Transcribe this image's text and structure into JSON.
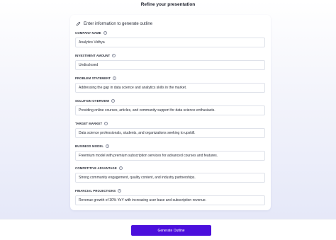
{
  "page_title": "Refine your presentation",
  "card": {
    "header_icon": "pencil-icon",
    "header_text": "Enter information to generate outline"
  },
  "fields": [
    {
      "label": "COMPANY NAME",
      "value": "Analytics Vidhya"
    },
    {
      "label": "INVESTMENT AMOUNT",
      "value": "Undisclosed"
    },
    {
      "label": "PROBLEM STATEMENT",
      "value": "Addressing the gap in data science and analytics skills in the market."
    },
    {
      "label": "SOLUTION OVERVIEW",
      "value": "Providing online courses, articles, and community support for data science enthusiasts."
    },
    {
      "label": "TARGET MARKET",
      "value": "Data science professionals, students, and organizations seeking to upskill."
    },
    {
      "label": "BUSINESS MODEL",
      "value": "Freemium model with premium subscription services for advanced courses and features."
    },
    {
      "label": "COMPETITIVE ADVANTAGE",
      "value": "Strong community engagement, quality content, and industry partnerships."
    },
    {
      "label": "FINANCIAL PROJECTIONS",
      "value": "Revenue growth of 30% YoY with increasing user base and subscription revenue."
    }
  ],
  "info_glyph": "i",
  "footer": {
    "generate_label": "Generate Outline"
  },
  "colors": {
    "accent": "#4b0fdc"
  }
}
